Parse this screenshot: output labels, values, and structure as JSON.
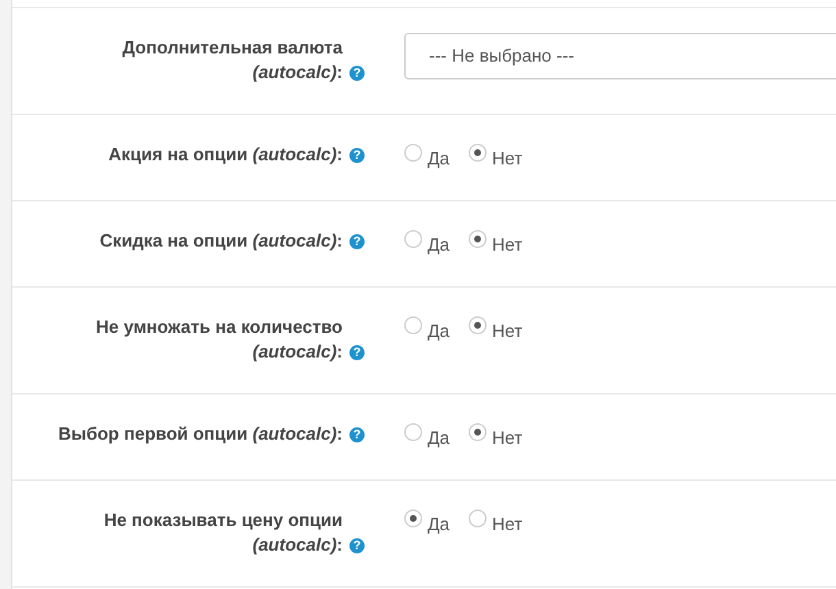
{
  "rows": [
    {
      "kind": "select",
      "label": "Дополнительная валюта *(autocalc)*:",
      "help": "?",
      "value": "--- Не выбрано ---"
    },
    {
      "kind": "radio",
      "label": "Акция на опции *(autocalc)*:",
      "help": "?",
      "options": [
        {
          "label": "Да",
          "selected": false
        },
        {
          "label": "Нет",
          "selected": true
        }
      ]
    },
    {
      "kind": "radio",
      "label": "Скидка на опции *(autocalc)*:",
      "help": "?",
      "options": [
        {
          "label": "Да",
          "selected": false
        },
        {
          "label": "Нет",
          "selected": true
        }
      ]
    },
    {
      "kind": "radio",
      "label": "Не умножать на количество *(autocalc)*:",
      "help": "?",
      "options": [
        {
          "label": "Да",
          "selected": false
        },
        {
          "label": "Нет",
          "selected": true
        }
      ]
    },
    {
      "kind": "radio",
      "label": "Выбор первой опции *(autocalc)*:",
      "help": "?",
      "options": [
        {
          "label": "Да",
          "selected": false
        },
        {
          "label": "Нет",
          "selected": true
        }
      ]
    },
    {
      "kind": "radio",
      "label": "Не показывать цену опции *(autocalc)*:",
      "help": "?",
      "options": [
        {
          "label": "Да",
          "selected": true
        },
        {
          "label": "Нет",
          "selected": false
        }
      ]
    }
  ]
}
